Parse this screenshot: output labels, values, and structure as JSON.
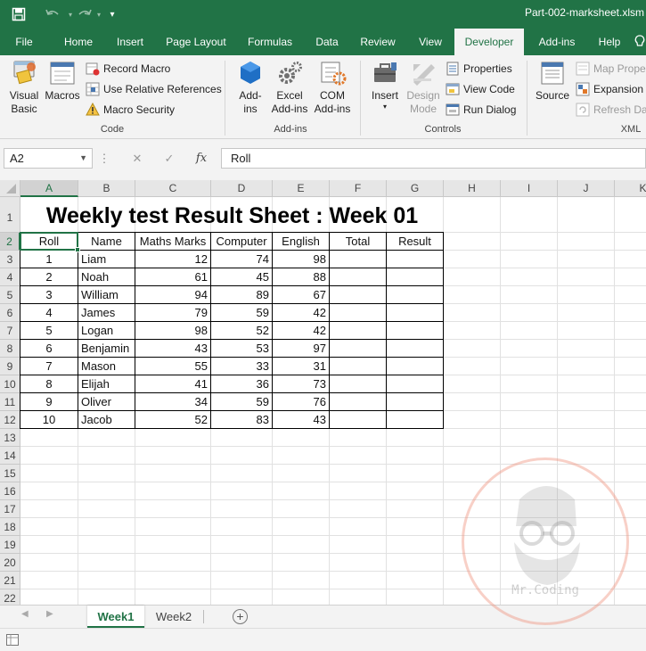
{
  "titlebar": {
    "filename": "Part-002-marksheet.xlsm",
    "save_icon": "save-icon",
    "undo_icon": "undo-icon",
    "redo_icon": "redo-icon",
    "customize_icon": "customize-qat-icon",
    "bg_color": "#217346"
  },
  "tabs": [
    {
      "label": "File"
    },
    {
      "label": "Home"
    },
    {
      "label": "Insert"
    },
    {
      "label": "Page Layout"
    },
    {
      "label": "Formulas"
    },
    {
      "label": "Data"
    },
    {
      "label": "Review"
    },
    {
      "label": "View"
    },
    {
      "label": "Developer",
      "active": true
    },
    {
      "label": "Add-ins"
    },
    {
      "label": "Help"
    }
  ],
  "ribbon": {
    "code": {
      "label": "Code",
      "visual_basic": "Visual Basic",
      "visual_basic_l1": "Visual",
      "visual_basic_l2": "Basic",
      "macros": "Macros",
      "record_macro": "Record Macro",
      "use_relative": "Use Relative References",
      "macro_security": "Macro Security"
    },
    "addins": {
      "label": "Add-ins",
      "addins_l1": "Add-",
      "addins_l2": "ins",
      "excel_l1": "Excel",
      "excel_l2": "Add-ins",
      "com_l1": "COM",
      "com_l2": "Add-ins"
    },
    "controls": {
      "label": "Controls",
      "insert": "Insert",
      "design_l1": "Design",
      "design_l2": "Mode",
      "properties": "Properties",
      "view_code": "View Code",
      "run_dialog": "Run Dialog"
    },
    "xml": {
      "label": "XML",
      "source": "Source",
      "map_properties": "Map Proper",
      "expansion_packs": "Expansion P",
      "refresh_data": "Refresh Data"
    }
  },
  "formula_bar": {
    "name_box": "A2",
    "cancel": "✕",
    "enter": "✓",
    "fx": "fx",
    "content": "Roll"
  },
  "sheet": {
    "columns": [
      "A",
      "B",
      "C",
      "D",
      "E",
      "F",
      "G",
      "H",
      "I",
      "J",
      "K"
    ],
    "rows": [
      "1",
      "2",
      "3",
      "4",
      "5",
      "6",
      "7",
      "8",
      "9",
      "10",
      "11",
      "12",
      "13",
      "14",
      "15",
      "16",
      "17",
      "18",
      "19",
      "20",
      "21",
      "22"
    ],
    "title": "Weekly test Result Sheet : Week 01",
    "headers": [
      "Roll",
      "Name",
      "Maths Marks",
      "Computer",
      "English",
      "Total",
      "Result"
    ],
    "data": [
      {
        "roll": "1",
        "name": "Liam",
        "maths": "12",
        "computer": "74",
        "english": "98"
      },
      {
        "roll": "2",
        "name": "Noah",
        "maths": "61",
        "computer": "45",
        "english": "88"
      },
      {
        "roll": "3",
        "name": "William",
        "maths": "94",
        "computer": "89",
        "english": "67"
      },
      {
        "roll": "4",
        "name": "James",
        "maths": "79",
        "computer": "59",
        "english": "42"
      },
      {
        "roll": "5",
        "name": "Logan",
        "maths": "98",
        "computer": "52",
        "english": "42"
      },
      {
        "roll": "6",
        "name": "Benjamin",
        "maths": "43",
        "computer": "53",
        "english": "97"
      },
      {
        "roll": "7",
        "name": "Mason",
        "maths": "55",
        "computer": "33",
        "english": "31"
      },
      {
        "roll": "8",
        "name": "Elijah",
        "maths": "41",
        "computer": "36",
        "english": "73"
      },
      {
        "roll": "9",
        "name": "Oliver",
        "maths": "34",
        "computer": "59",
        "english": "76"
      },
      {
        "roll": "10",
        "name": "Jacob",
        "maths": "52",
        "computer": "83",
        "english": "43"
      }
    ],
    "accent_color": "#217346"
  },
  "sheet_tabs": {
    "tabs": [
      "Week1",
      "Week2"
    ],
    "active": "Week1",
    "add": "+"
  },
  "watermark": {
    "text": "Mr.Coding"
  }
}
